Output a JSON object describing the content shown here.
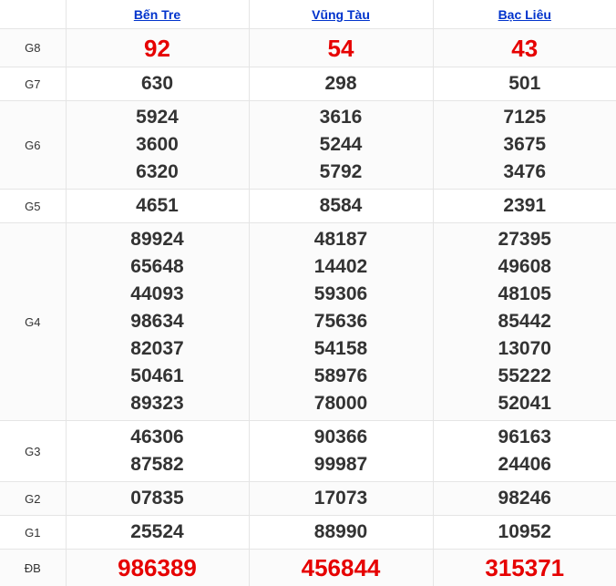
{
  "provinces": [
    "Bến Tre",
    "Vũng Tàu",
    "Bạc Liêu"
  ],
  "rows": [
    {
      "label": "G8",
      "values": [
        [
          "92"
        ],
        [
          "54"
        ],
        [
          "43"
        ]
      ]
    },
    {
      "label": "G7",
      "values": [
        [
          "630"
        ],
        [
          "298"
        ],
        [
          "501"
        ]
      ]
    },
    {
      "label": "G6",
      "values": [
        [
          "5924",
          "3600",
          "6320"
        ],
        [
          "3616",
          "5244",
          "5792"
        ],
        [
          "7125",
          "3675",
          "3476"
        ]
      ]
    },
    {
      "label": "G5",
      "values": [
        [
          "4651"
        ],
        [
          "8584"
        ],
        [
          "2391"
        ]
      ]
    },
    {
      "label": "G4",
      "values": [
        [
          "89924",
          "65648",
          "44093",
          "98634",
          "82037",
          "50461",
          "89323"
        ],
        [
          "48187",
          "14402",
          "59306",
          "75636",
          "54158",
          "58976",
          "78000"
        ],
        [
          "27395",
          "49608",
          "48105",
          "85442",
          "13070",
          "55222",
          "52041"
        ]
      ]
    },
    {
      "label": "G3",
      "values": [
        [
          "46306",
          "87582"
        ],
        [
          "90366",
          "99987"
        ],
        [
          "96163",
          "24406"
        ]
      ]
    },
    {
      "label": "G2",
      "values": [
        [
          "07835"
        ],
        [
          "17073"
        ],
        [
          "98246"
        ]
      ]
    },
    {
      "label": "G1",
      "values": [
        [
          "25524"
        ],
        [
          "88990"
        ],
        [
          "10952"
        ]
      ]
    },
    {
      "label": "ĐB",
      "values": [
        [
          "986389"
        ],
        [
          "456844"
        ],
        [
          "315371"
        ]
      ]
    }
  ],
  "colors": {
    "link": "#0033cc",
    "highlight": "#e60000",
    "text": "#333333"
  }
}
